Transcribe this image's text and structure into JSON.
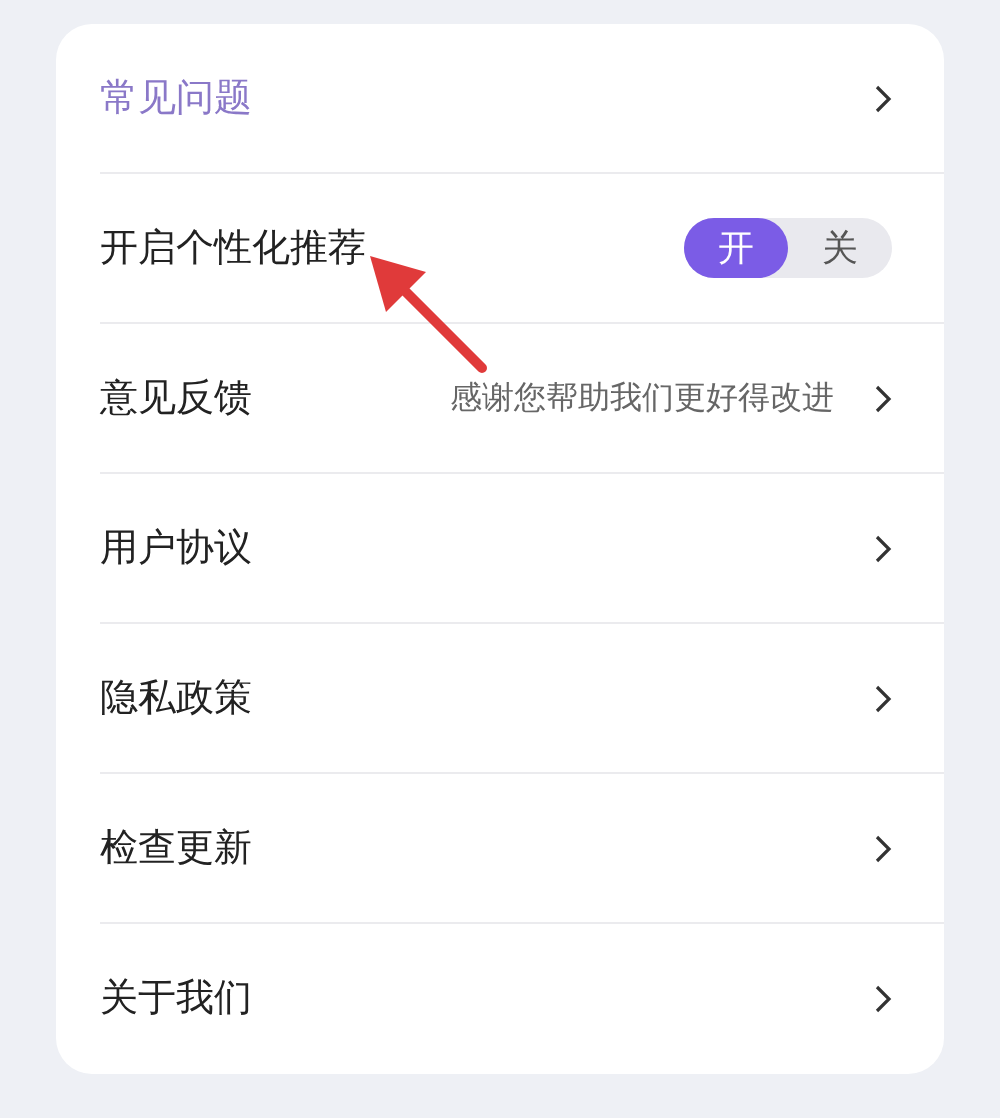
{
  "rows": [
    {
      "kind": "link",
      "label": "常见问题",
      "highlighted": true
    },
    {
      "kind": "toggle",
      "label": "开启个性化推荐",
      "highlighted": false,
      "options": [
        {
          "label": "开",
          "selected": true
        },
        {
          "label": "关",
          "selected": false
        }
      ]
    },
    {
      "kind": "link",
      "label": "意见反馈",
      "highlighted": false,
      "hint": "感谢您帮助我们更好得改进"
    },
    {
      "kind": "link",
      "label": "用户协议",
      "highlighted": false
    },
    {
      "kind": "link",
      "label": "隐私政策",
      "highlighted": false
    },
    {
      "kind": "link",
      "label": "检查更新",
      "highlighted": false
    },
    {
      "kind": "link",
      "label": "关于我们",
      "highlighted": false
    }
  ]
}
